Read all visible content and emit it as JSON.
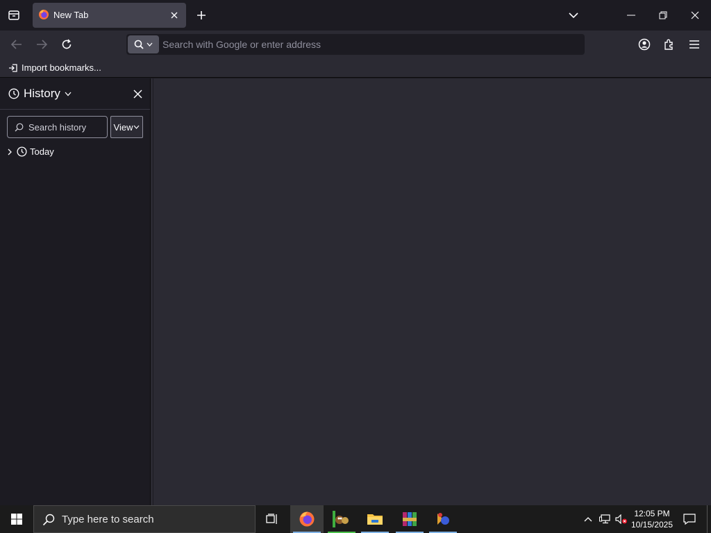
{
  "tabs": [
    {
      "title": "New Tab",
      "active": true
    }
  ],
  "urlbar": {
    "placeholder": "Search with Google or enter address"
  },
  "bookmarks_bar": {
    "import_label": "Import bookmarks..."
  },
  "sidebar": {
    "title": "History",
    "search_placeholder": "Search history",
    "view_label": "View",
    "groups": [
      {
        "label": "Today",
        "expanded": false
      }
    ]
  },
  "taskbar": {
    "search_placeholder": "Type here to search",
    "time": "12:05 PM",
    "date": "10/15/2025",
    "apps": [
      "firefox-icon",
      "game-icon",
      "file-explorer-icon",
      "winrar-icon",
      "app-icon"
    ]
  },
  "colors": {
    "toolbar": "#2b2a33",
    "tabstrip": "#1c1b22",
    "active_tab": "#42414d",
    "taskbar": "#1b1b1b"
  }
}
